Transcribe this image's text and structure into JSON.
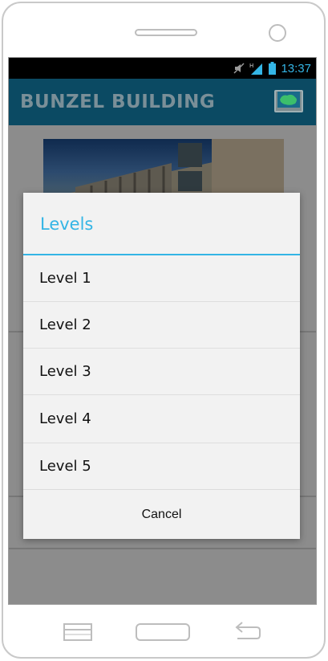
{
  "status_bar": {
    "time": "13:37",
    "icons": [
      "mute-icon",
      "signal-icon",
      "battery-icon"
    ],
    "network_type": "H"
  },
  "action_bar": {
    "title": "BUNZEL BUILDING",
    "map_button_icon": "map-icon"
  },
  "dialog": {
    "title": "Levels",
    "items": [
      {
        "label": "Level 1"
      },
      {
        "label": "Level 2"
      },
      {
        "label": "Level 3"
      },
      {
        "label": "Level 4"
      },
      {
        "label": "Level 5"
      }
    ],
    "cancel_label": "Cancel"
  },
  "nav": {
    "menu_icon": "menu-icon",
    "home_icon": "home-icon",
    "back_icon": "back-icon"
  },
  "colors": {
    "accent": "#34b5e5",
    "action_bar": "#0b4a63",
    "dialog_bg": "#f2f2f2"
  }
}
